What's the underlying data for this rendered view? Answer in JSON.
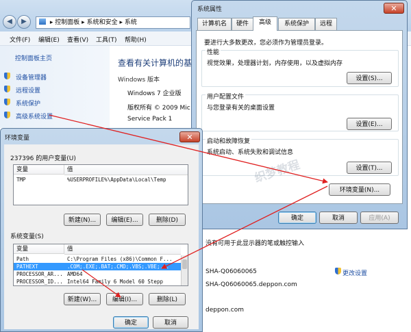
{
  "explorer": {
    "address": {
      "part1": "控制面板",
      "sep1": "▸",
      "part2": "系统和安全",
      "sep2": "▸",
      "part3": "系统"
    },
    "menu": [
      "文件(F)",
      "编辑(E)",
      "查看(V)",
      "工具(T)",
      "帮助(H)"
    ],
    "sidebar_home": "控制面板主页",
    "sidebar_links": [
      "设备管理器",
      "远程设置",
      "系统保护",
      "高级系统设置"
    ],
    "main_heading": "查看有关计算机的基",
    "windows_edition_label": "Windows 版本",
    "edition": "Windows 7 企业版",
    "copyright": "版权所有 © 2009 Mic",
    "service_pack": "Service Pack 1",
    "pen_touch": "没有可用于此显示器的笔或触控输入",
    "computer_name": "SHA-Q06060065",
    "change_settings": "更改设置",
    "full_name": "SHA-Q06060065.deppon.com",
    "domain": "deppon.com"
  },
  "sysprops": {
    "title": "系统属性",
    "close": "✕",
    "tabs": [
      "计算机名",
      "硬件",
      "高级",
      "系统保护",
      "远程"
    ],
    "active_tab": 2,
    "admin_note": "要进行大多数更改，您必须作为管理员登录。",
    "perf_title": "性能",
    "perf_desc": "视觉效果，处理器计划，内存使用，以及虚拟内存",
    "settings1": "设置(S)...",
    "profile_title": "用户配置文件",
    "profile_desc": "与您登录有关的桌面设置",
    "settings2": "设置(E)...",
    "startup_title": "启动和故障恢复",
    "startup_desc": "系统启动、系统失败和调试信息",
    "settings3": "设置(T)...",
    "envvars": "环境变量(N)...",
    "ok": "确定",
    "cancel": "取消",
    "apply": "应用(A)"
  },
  "envdlg": {
    "title": "环境变量",
    "close": "✕",
    "user_group": "237396 的用户变量(U)",
    "col_var": "变量",
    "col_val": "值",
    "user_vars": [
      {
        "name": "TMP",
        "value": "%USERPROFILE%\\AppData\\Local\\Temp"
      }
    ],
    "user_new": "新建(N)...",
    "user_edit": "编辑(E)...",
    "user_delete": "删除(D)",
    "sys_group": "系统变量(S)",
    "sys_vars": [
      {
        "name": "Path",
        "value": "C:\\Program Files (x86)\\Common F..."
      },
      {
        "name": "PATHEXT",
        "value": ".COM;.EXE;.BAT;.CMD;.VBS;.VBE;..."
      },
      {
        "name": "PROCESSOR_AR...",
        "value": "AMD64"
      },
      {
        "name": "PROCESSOR_ID...",
        "value": "Intel64 Family 6 Model 60 Stepp"
      }
    ],
    "sys_selected": 1,
    "sys_new": "新建(W)...",
    "sys_edit": "编辑(I)...",
    "sys_delete": "删除(L)",
    "ok": "确定",
    "cancel": "取消"
  },
  "watermark": "织梦教程",
  "colors": {
    "arrow": "#e02020",
    "selection": "#3399ff",
    "link": "#1f4fa3"
  }
}
